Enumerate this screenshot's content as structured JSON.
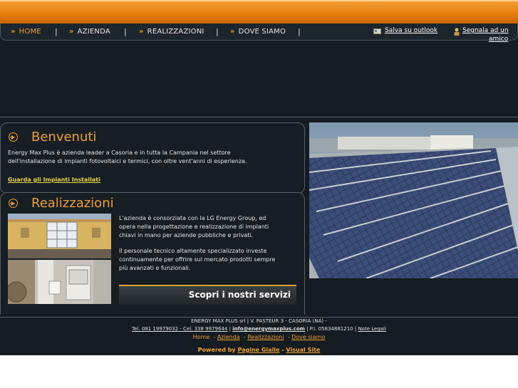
{
  "nav": {
    "items": [
      {
        "label": "HOME"
      },
      {
        "label": "AZIENDA"
      },
      {
        "label": "REALIZZAZIONI"
      },
      {
        "label": "DOVE SIAMO"
      }
    ],
    "separator": "|",
    "save_outlook": "Salva su outlook",
    "share_friend_line1": "Segnala ad un",
    "share_friend_line2": "amico"
  },
  "welcome": {
    "title": "Benvenuti",
    "text_line1": "Energy Max Plus è azienda leader a Casoria e in tutta la Campania nel settore",
    "text_line2": "dell'installazione di impianti fotovoltaici e termici, con oltre vent'anni di esperienza.",
    "link": "Guarda gli Impianti Installati"
  },
  "realizzazioni": {
    "title": "Realizzazioni",
    "p1_line1": "L'azienda è consorziata con la LG Energy Group, ed",
    "p1_line2": "opera nella progettazione e realizzazione di impianti",
    "p1_line3": "chiavi in mano per aziende pubbliche e privati.",
    "p2_line1": "Il personale tecnico altamente specializzato investe",
    "p2_line2": "continuamente per offrire sul mercato prodotti sempre",
    "p2_line3": "più avanzati e funzionali.",
    "button": "Scopri i nostri servizi"
  },
  "footer": {
    "line1": "ENERGY MAX PLUS srl | V. PASTEUR 3 - CASORIA (NA) -",
    "phone": "Tel. 081 19979032 - Cel. 338 9979644",
    "email": "info@energymaxplus.com",
    "piva": "P.I. 05834881210",
    "legal": "Note Legali",
    "links": [
      "Home",
      "Azienda",
      "Realizzazioni",
      "Dove siamo"
    ],
    "link_sep": "-",
    "powered_by": "Powered by",
    "pg": "Pagine Gialle",
    "vs": "Visual Site"
  },
  "colors": {
    "accent": "#f0a030",
    "header_orange": "#e8820d",
    "background": "#141b21",
    "link_yellow": "#e8d44a"
  }
}
